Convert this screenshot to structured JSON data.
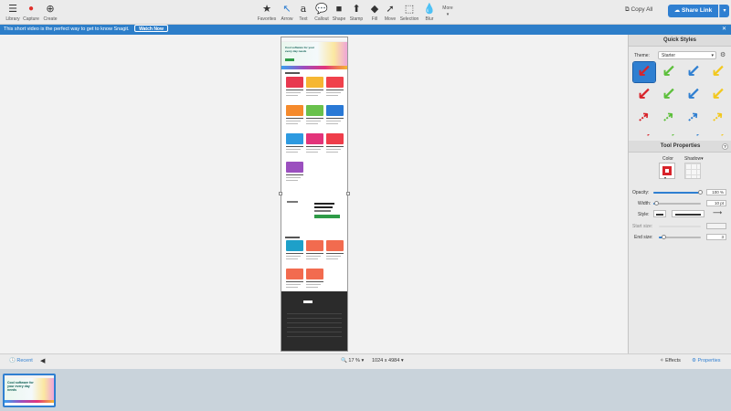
{
  "toolbar": {
    "left": [
      {
        "label": "Library",
        "icon": "hamburger-icon"
      },
      {
        "label": "Capture",
        "icon": "record-icon",
        "color": "#e0302b"
      },
      {
        "label": "Create",
        "icon": "plus-icon"
      }
    ],
    "tools": [
      {
        "label": "Favorites",
        "icon": "star-icon"
      },
      {
        "label": "Arrow",
        "icon": "arrow-icon",
        "color": "#2f7fd1"
      },
      {
        "label": "Text",
        "icon": "text-icon"
      },
      {
        "label": "Callout",
        "icon": "callout-icon"
      },
      {
        "label": "Shape",
        "icon": "shape-icon"
      },
      {
        "label": "Stamp",
        "icon": "stamp-icon"
      },
      {
        "label": "Fill",
        "icon": "fill-icon"
      },
      {
        "label": "Move",
        "icon": "move-icon"
      },
      {
        "label": "Selection",
        "icon": "selection-icon"
      },
      {
        "label": "Blur",
        "icon": "blur-icon"
      }
    ],
    "more_label": "More",
    "copy_all_label": "Copy All",
    "share_link_label": "Share Link"
  },
  "banner": {
    "text": "This short video is the perfect way to get to know Snagit.",
    "button_label": "Watch Now"
  },
  "canvas": {
    "doc_hero_title": "Cool software for your every day needs",
    "tile_colors": [
      "#e8384f",
      "#f6b733",
      "#f0414c",
      "#f58a2c",
      "#69c14c",
      "#2a79d6",
      "#2d9ae0",
      "#e3347a",
      "#ef3d4a",
      "#9b4fbf"
    ],
    "tile_colors_2": [
      "#1ea0c9",
      "#f26b4f",
      "#f26b4f",
      "#f26b4f",
      "#f26b4f"
    ]
  },
  "panel": {
    "quick_styles_title": "Quick Styles",
    "theme_label": "Theme:",
    "theme_value": "Starter",
    "tool_properties_title": "Tool Properties",
    "help_label": "?",
    "color_label": "Color",
    "shadow_label": "Shadow",
    "color_value": "#d8232a",
    "opacity_label": "Opacity:",
    "opacity_value": "100 %",
    "opacity_level": 1.0,
    "width_label": "Width:",
    "width_value": "10 pt",
    "width_level": 0.08,
    "style_label": "Style:",
    "start_size_label": "Start size:",
    "end_size_label": "End size:",
    "end_size_value": "3",
    "end_size_level": 0.12,
    "style_colors": [
      "#d8232a",
      "#5cbf3a",
      "#2f7fd1",
      "#f2c81e"
    ]
  },
  "bottom": {
    "recent_label": "Recent",
    "zoom_value": "17 %",
    "dimensions": "1024 x 4984",
    "effects_label": "Effects",
    "properties_label": "Properties"
  }
}
